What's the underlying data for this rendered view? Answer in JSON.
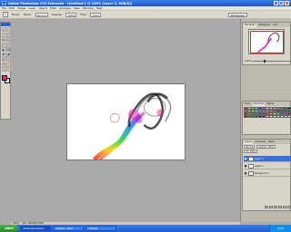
{
  "window": {
    "title": "Adobe Photoshop CS3 Extended - [Untitled-1 @ 100% (Layer 2, RGB/8)]",
    "logo": "Ps"
  },
  "menu": [
    "File",
    "Edit",
    "Image",
    "Layer",
    "Select",
    "Filter",
    "Analysis",
    "View",
    "Window",
    "Help"
  ],
  "options": {
    "brush_label": "Brush:",
    "mode_label": "Mode:",
    "mode_value": "Normal",
    "opacity_label": "Opacity:",
    "opacity_value": "100%",
    "flow_label": "Flow:",
    "flow_value": "100%",
    "workspace": "Workspace"
  },
  "toolbox": {
    "tools": [
      "▹",
      "⬚",
      "⌇",
      "✂",
      "⧉",
      "✎",
      "⌁",
      "✐",
      "◐",
      "⌫",
      "▰",
      "◉",
      "✒",
      "T",
      "⬡",
      "✋",
      "🔍",
      "⌖"
    ],
    "foreground_color": "#e6209a",
    "background_color": "#ffffff"
  },
  "navigator": {
    "tabs": [
      "Navigator",
      "Histogram",
      "Info"
    ],
    "zoom": "100%"
  },
  "swatches": {
    "tabs": [
      "Color",
      "Swatches",
      "Styles"
    ],
    "colors": [
      "#ff0000",
      "#ffff00",
      "#00ff00",
      "#00ffff",
      "#0000ff",
      "#ff00ff",
      "#ffffff",
      "#e0e0e0",
      "#c0c0c0",
      "#a0a0a0",
      "#808080",
      "#404040",
      "#000000",
      "#ff6666",
      "#ffcc66",
      "#99ff66",
      "#66ffcc",
      "#6699ff",
      "#cc66ff",
      "#ff9999",
      "#cc9966",
      "#996633",
      "#663300",
      "#336600",
      "#006633",
      "#003366",
      "#cc0000",
      "#cc9900",
      "#339900",
      "#009999",
      "#003399",
      "#990099",
      "#ff3366",
      "#ff9933",
      "#ccff33",
      "#33ffcc",
      "#3366ff",
      "#9933ff",
      "#660033",
      "#800000",
      "#806600",
      "#336600",
      "#006666",
      "#000066",
      "#660066",
      "#ffcccc",
      "#ffeecc",
      "#eeffcc",
      "#ccffee",
      "#cceeff",
      "#eeccff",
      "#f0f0f0"
    ]
  },
  "layers": {
    "tabs": [
      "Layers",
      "Channels",
      "Paths"
    ],
    "blend": "Normal",
    "opacity": "Opacity: 100%",
    "fill": "Fill: 100%",
    "items": [
      {
        "name": "Layer 2",
        "active": true
      },
      {
        "name": "Layer 1",
        "active": false
      },
      {
        "name": "Background",
        "active": false
      }
    ]
  },
  "status": {
    "zoom": "100%",
    "doc": "Doc: 900.0K/2.38M"
  },
  "taskbar": {
    "start": "start",
    "tasks": [
      "Adobe Photoshop...",
      "Untitled - Paint",
      "Untitled"
    ],
    "time": "3:24"
  }
}
